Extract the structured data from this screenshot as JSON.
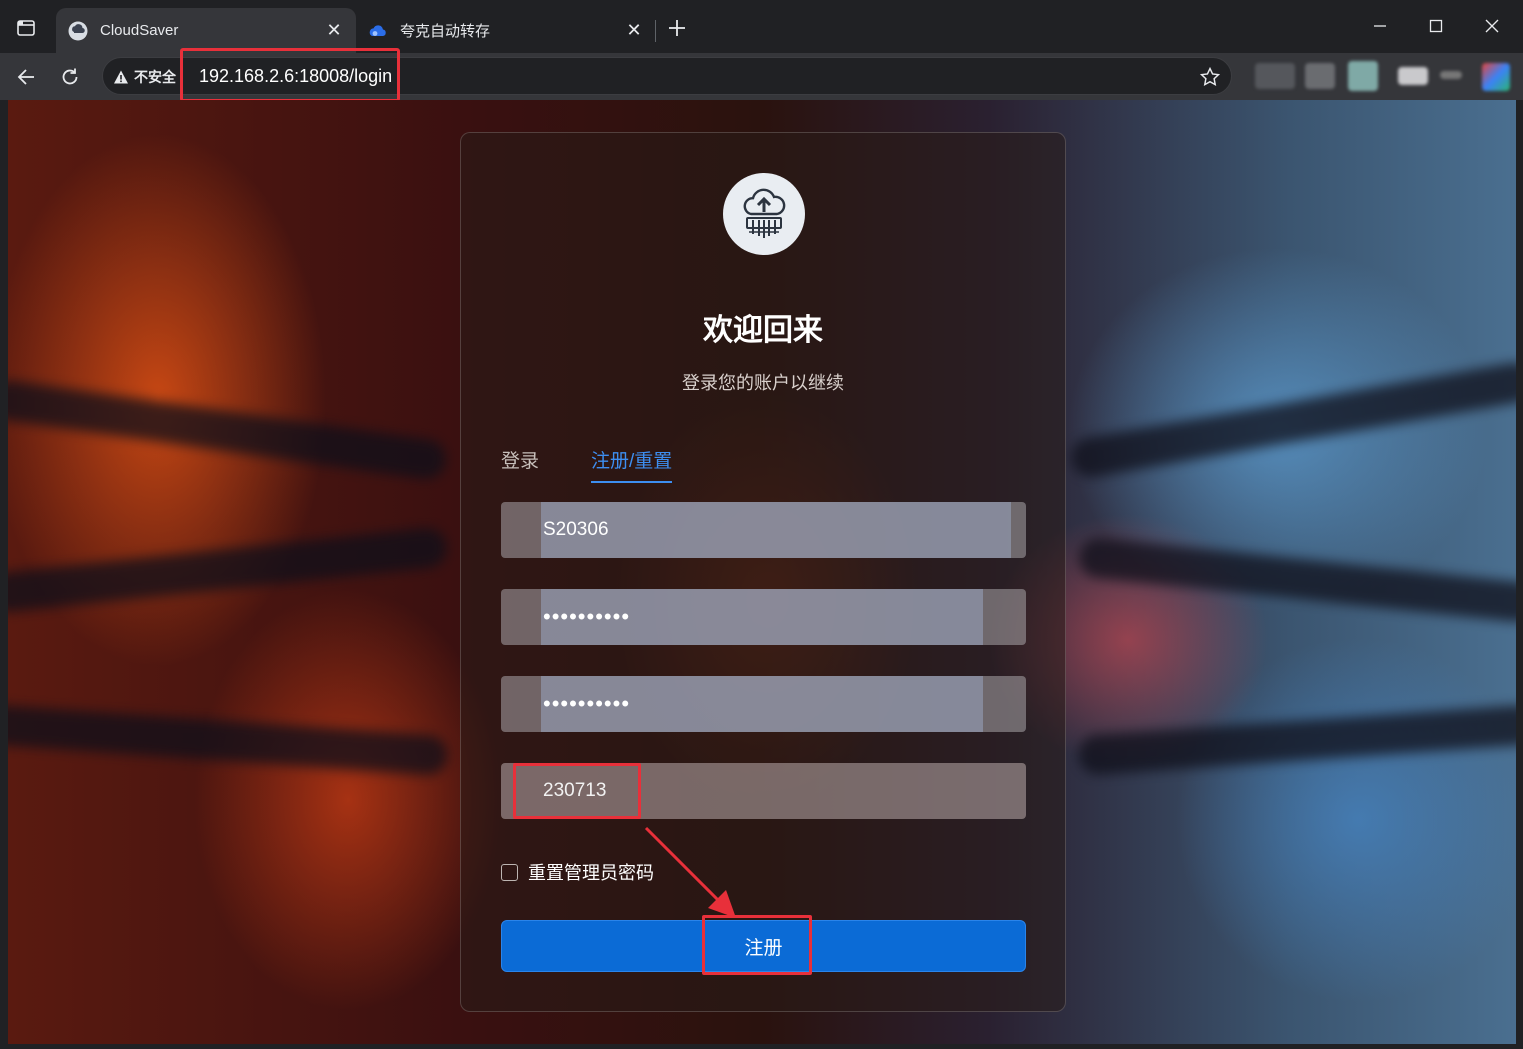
{
  "browser": {
    "tabs": [
      {
        "title": "CloudSaver",
        "active": true,
        "favicon": "cloudsaver-logo-icon"
      },
      {
        "title": "夸克自动转存",
        "active": false,
        "favicon": "quark-cloud-icon"
      }
    ],
    "address": {
      "security_label": "不安全",
      "url": "192.168.2.6:18008/login"
    }
  },
  "login": {
    "heading": "欢迎回来",
    "subheading": "登录您的账户以继续",
    "tabs": [
      {
        "label": "登录",
        "active": false
      },
      {
        "label": "注册/重置",
        "active": true
      }
    ],
    "fields": {
      "username": "S20306",
      "password": "••••••••••",
      "confirm_password": "••••••••••",
      "code": "230713"
    },
    "reset_admin_label": "重置管理员密码",
    "reset_admin_checked": false,
    "submit_label": "注册"
  },
  "colors": {
    "accent": "#0b6bd6",
    "tab_active": "#3d8ef0",
    "highlight": "#e8303a"
  }
}
